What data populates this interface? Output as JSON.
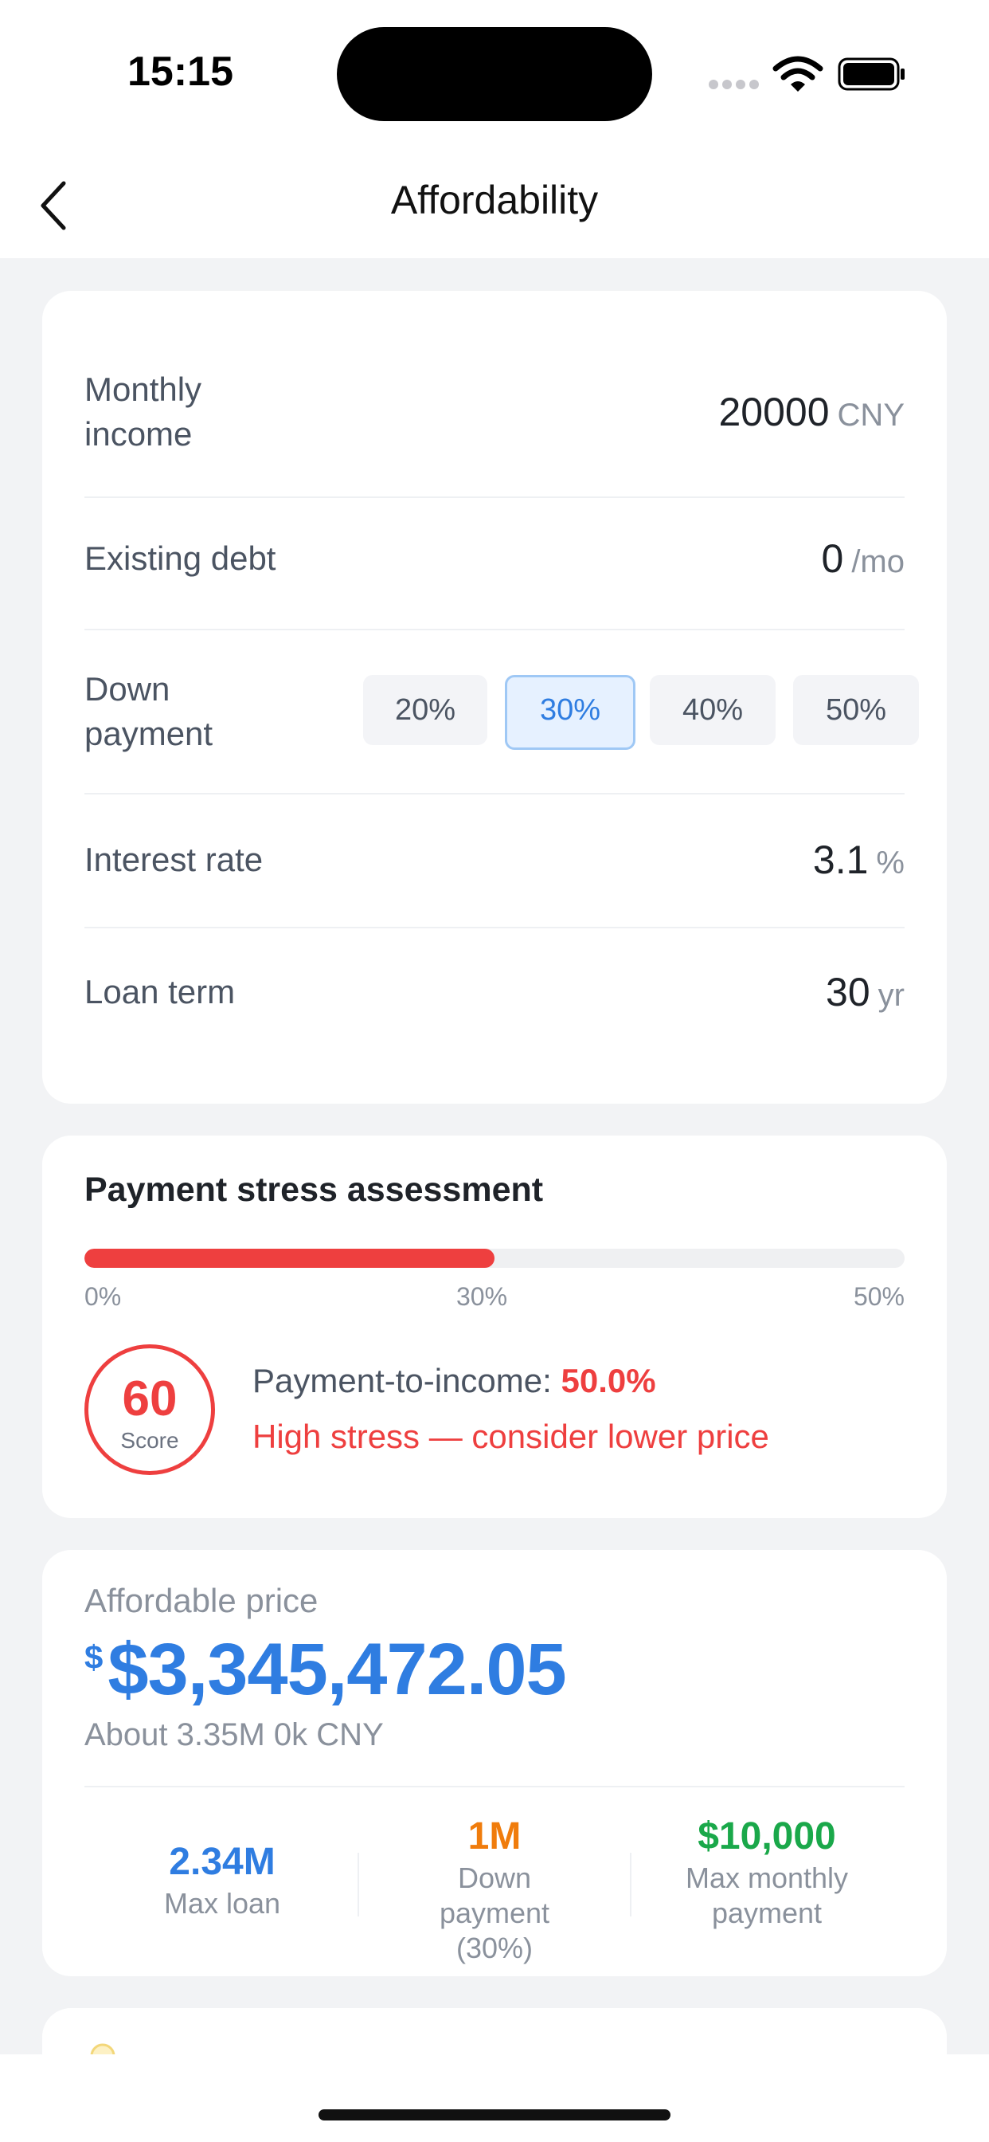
{
  "status_bar": {
    "time": "15:15"
  },
  "nav": {
    "title": "Affordability"
  },
  "inputs": {
    "monthly_income": {
      "label": "Monthly income",
      "value": "20000",
      "unit": "CNY"
    },
    "existing_debt": {
      "label": "Existing debt",
      "value": "0",
      "unit": "/mo"
    },
    "down_payment": {
      "label": "Down payment",
      "options": [
        "20%",
        "30%",
        "40%",
        "50%"
      ],
      "selected": "30%"
    },
    "interest_rate": {
      "label": "Interest rate",
      "value": "3.1",
      "unit": "%"
    },
    "loan_term": {
      "label": "Loan term",
      "value": "30",
      "unit": "yr"
    }
  },
  "stress": {
    "title": "Payment stress assessment",
    "bar_fill_fraction": 0.5,
    "ticks": [
      "0%",
      "30%",
      "50%"
    ],
    "score": "60",
    "score_label": "Score",
    "pti_label": "Payment-to-income:",
    "pti_value": "50.0%",
    "message": "High stress — consider lower price"
  },
  "affordable": {
    "label": "Affordable price",
    "currency_symbol": "$",
    "price": "$3,345,472.05",
    "about": "About 3.35M 0k CNY",
    "stats": [
      {
        "value": "2.34M",
        "label": "Max loan",
        "color": "#2f7de1"
      },
      {
        "value": "1M",
        "label": "Down payment (30%)",
        "color": "#f07c0c"
      },
      {
        "value": "$10,000",
        "label": "Max monthly payment",
        "color": "#1aa84a"
      }
    ]
  },
  "colors": {
    "accent": "#2f7de1",
    "danger": "#ee3f3f",
    "warning": "#f07c0c",
    "success": "#1aa84a"
  }
}
